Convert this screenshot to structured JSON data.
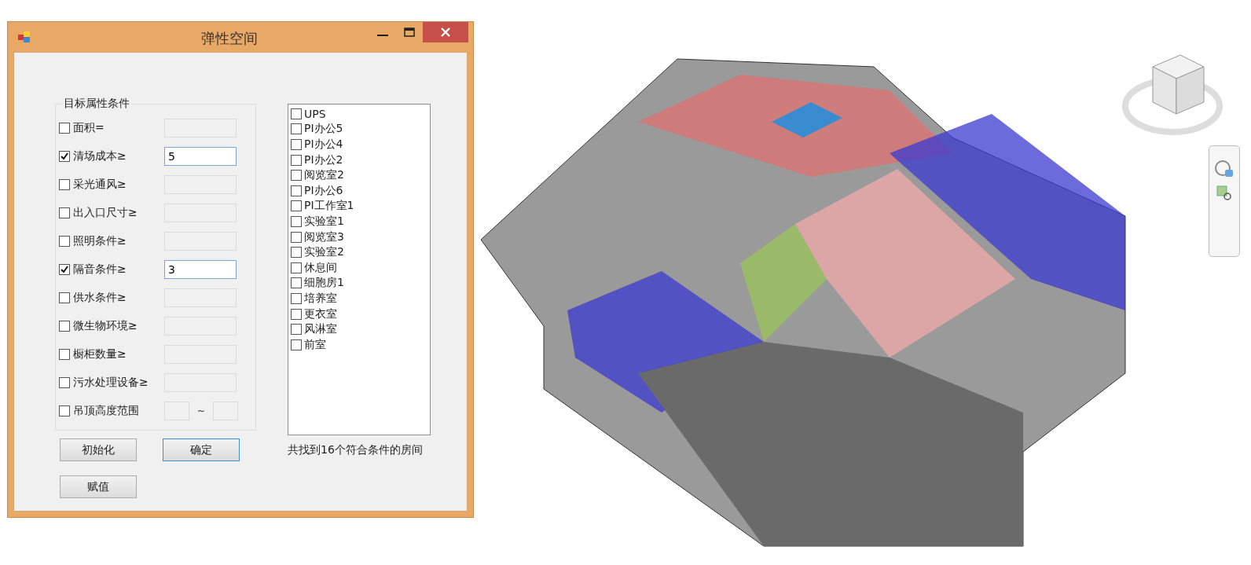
{
  "window": {
    "title": "弹性空间"
  },
  "group": {
    "title": "目标属性条件"
  },
  "conditions": [
    {
      "kind": "single",
      "label": "面积=",
      "checked": false
    },
    {
      "kind": "single",
      "label": "清场成本≥",
      "checked": true,
      "value": "5"
    },
    {
      "kind": "single",
      "label": "采光通风≥",
      "checked": false
    },
    {
      "kind": "single",
      "label": "出入口尺寸≥",
      "checked": false
    },
    {
      "kind": "single",
      "label": "照明条件≥",
      "checked": false
    },
    {
      "kind": "single",
      "label": "隔音条件≥",
      "checked": true,
      "value": "3"
    },
    {
      "kind": "single",
      "label": "供水条件≥",
      "checked": false
    },
    {
      "kind": "single",
      "label": "微生物环境≥",
      "checked": false
    },
    {
      "kind": "single",
      "label": "橱柜数量≥",
      "checked": false
    },
    {
      "kind": "single",
      "label": "污水处理设备≥",
      "checked": false
    },
    {
      "kind": "range",
      "label": "吊顶高度范围",
      "checked": false,
      "separator": "~"
    }
  ],
  "rooms": [
    {
      "label": "UPS",
      "checked": false
    },
    {
      "label": "PI办公5",
      "checked": false
    },
    {
      "label": "PI办公4",
      "checked": false
    },
    {
      "label": "PI办公2",
      "checked": false
    },
    {
      "label": "阅览室2",
      "checked": false
    },
    {
      "label": "PI办公6",
      "checked": false
    },
    {
      "label": "PI工作室1",
      "checked": false
    },
    {
      "label": "实验室1",
      "checked": false
    },
    {
      "label": "阅览室3",
      "checked": false
    },
    {
      "label": "实验室2",
      "checked": false
    },
    {
      "label": "休息间",
      "checked": false
    },
    {
      "label": "细胞房1",
      "checked": false
    },
    {
      "label": "培养室",
      "checked": false
    },
    {
      "label": "更衣室",
      "checked": false
    },
    {
      "label": "风淋室",
      "checked": false
    },
    {
      "label": "前室",
      "checked": false
    }
  ],
  "buttons": [
    {
      "label": "初始化",
      "selected": false
    },
    {
      "label": "确定",
      "selected": true
    },
    {
      "label": "赋值",
      "selected": false
    }
  ],
  "result": "共找到16个符合条件的房间"
}
